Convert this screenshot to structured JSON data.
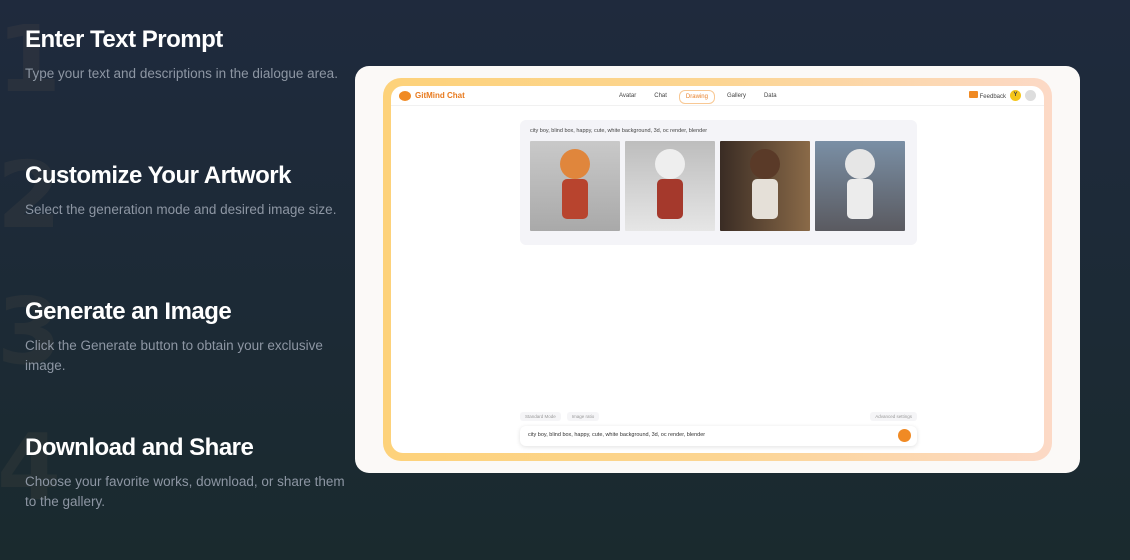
{
  "steps": [
    {
      "number": "1",
      "title": "Enter Text Prompt",
      "desc": "Type your text and descriptions in the dialogue area."
    },
    {
      "number": "2",
      "title": "Customize Your Artwork",
      "desc": "Select the generation mode and desired image size."
    },
    {
      "number": "3",
      "title": "Generate an Image",
      "desc": "Click the Generate button to obtain your exclusive image."
    },
    {
      "number": "4",
      "title": "Download and Share",
      "desc": "Choose your favorite works, download, or share them to the gallery."
    }
  ],
  "app": {
    "brand": "GitMind Chat",
    "nav": [
      "Avatar",
      "Chat",
      "Drawing",
      "Gallery",
      "Data"
    ],
    "feedback": "Feedback",
    "avatar_letter": "Y",
    "prompt": "city boy, blind box, happy, cute, white background, 3d, oc render, blender",
    "mode": "Standard Mode",
    "ratio": "Image ratio",
    "advanced": "Advanced settings",
    "input_value": "city boy, blind box, happy, cute, white background, 3d, oc render, blender"
  },
  "colors": {
    "accent": "#f08a24"
  }
}
